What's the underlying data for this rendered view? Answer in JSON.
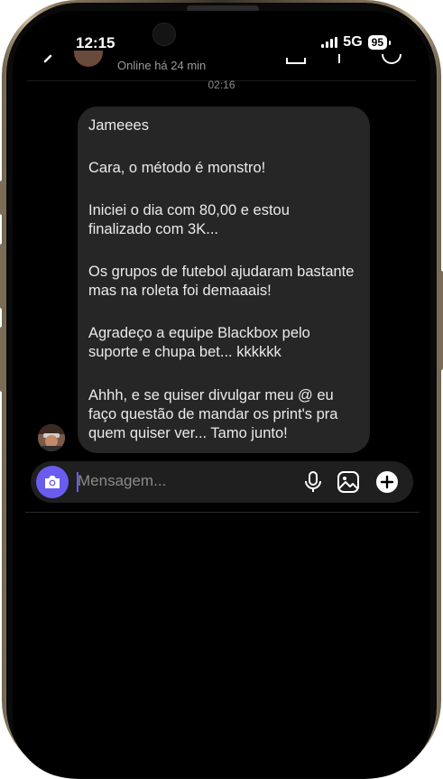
{
  "status_bar": {
    "time": "12:15",
    "network": "5G",
    "battery": "95"
  },
  "header": {
    "online_status": "Online há 24 min"
  },
  "conversation": {
    "timestamp": "02:16",
    "message_paragraphs": [
      "Jameees",
      "Cara, o método é monstro!",
      "Iniciei o dia com 80,00 e estou finalizado com 3K...",
      "Os grupos de futebol ajudaram bastante mas na roleta foi demaaais!",
      "Agradeço a equipe Blackbox pelo suporte e chupa bet... kkkkkk",
      "Ahhh, e se quiser divulgar meu @ eu faço questão de mandar os print's pra quem quiser ver... Tamo junto!"
    ]
  },
  "composer": {
    "placeholder": "Mensagem..."
  },
  "icons": {
    "camera": "camera-icon",
    "mic": "microphone-icon",
    "gallery": "image-icon",
    "add": "plus-circle-icon"
  },
  "colors": {
    "accent": "#6b5cf0",
    "bubble": "#262626",
    "background": "#000000"
  }
}
